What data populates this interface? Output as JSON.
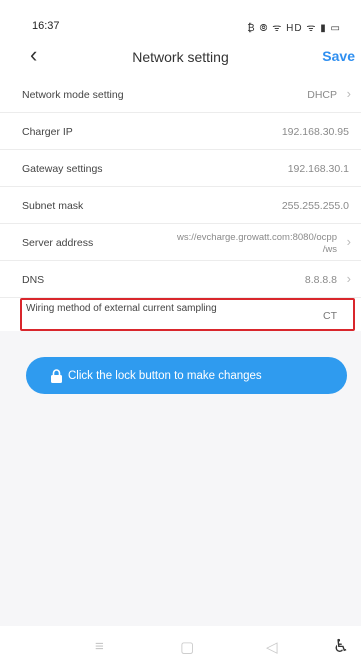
{
  "status_bar": {
    "time": "16:37",
    "icons_text": "₿ ⦾ ᯤ HD ᯤ ▮ ▭"
  },
  "nav": {
    "back_glyph": "‹",
    "title": "Network setting",
    "save_label": "Save"
  },
  "settings": [
    {
      "label": "Network mode setting",
      "value": "DHCP"
    },
    {
      "label": "Charger IP",
      "value": "192.168.30.95"
    },
    {
      "label": "Gateway settings",
      "value": "192.168.30.1"
    },
    {
      "label": "Subnet mask",
      "value": "255.255.255.0"
    },
    {
      "label": "Server address",
      "value_line1": "ws://evcharge.growatt.com:8080/ocpp",
      "value_line2": "/ws"
    },
    {
      "label": "DNS",
      "value": "8.8.8.8"
    },
    {
      "label": "Wiring method of external current sampling",
      "value": "CT"
    }
  ],
  "lock_banner": {
    "text": "Click the lock button to make changes"
  },
  "bottom_nav": {
    "menu_glyph": "≡",
    "home_glyph": "▢",
    "back_glyph": "◁",
    "accessibility_glyph": "♿"
  },
  "colors": {
    "accent": "#2f9bef",
    "highlight_border": "#d9262c",
    "background": "#f6f6f8"
  },
  "icons": {
    "lock": "lock-icon",
    "chevron": "chevron-right-icon"
  }
}
